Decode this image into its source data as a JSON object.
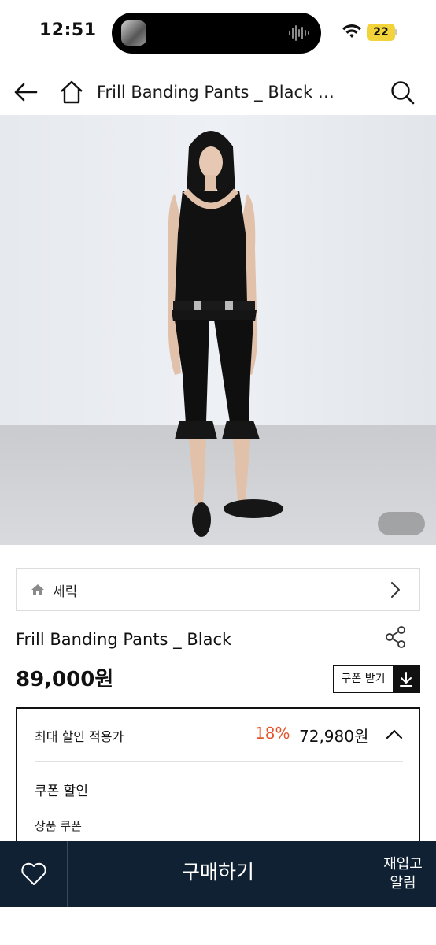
{
  "status_bar": {
    "time": "12:51",
    "battery": "22",
    "icons": [
      "wifi-icon",
      "battery-icon",
      "audio-waveform-icon"
    ]
  },
  "header": {
    "title": "Frill Banding Pants _ Black –…",
    "icons": [
      "back-arrow-icon",
      "home-icon",
      "search-icon"
    ]
  },
  "brand": {
    "name": "세릭"
  },
  "product": {
    "name": "Frill Banding Pants _ Black",
    "price": "89,000원",
    "coupon_button": "쿠폰 받기"
  },
  "discount": {
    "label": "최대 할인 적용가",
    "rate": "18%",
    "price": "72,980원",
    "coupon_discount": "쿠폰 할인",
    "product_coupon": "상품 쿠폰",
    "rate_color": "#e4572e"
  },
  "bottom_bar": {
    "buy_label": "구매하기",
    "restock_line1": "재입고",
    "restock_line2": "알림",
    "background": "#0f2133"
  }
}
